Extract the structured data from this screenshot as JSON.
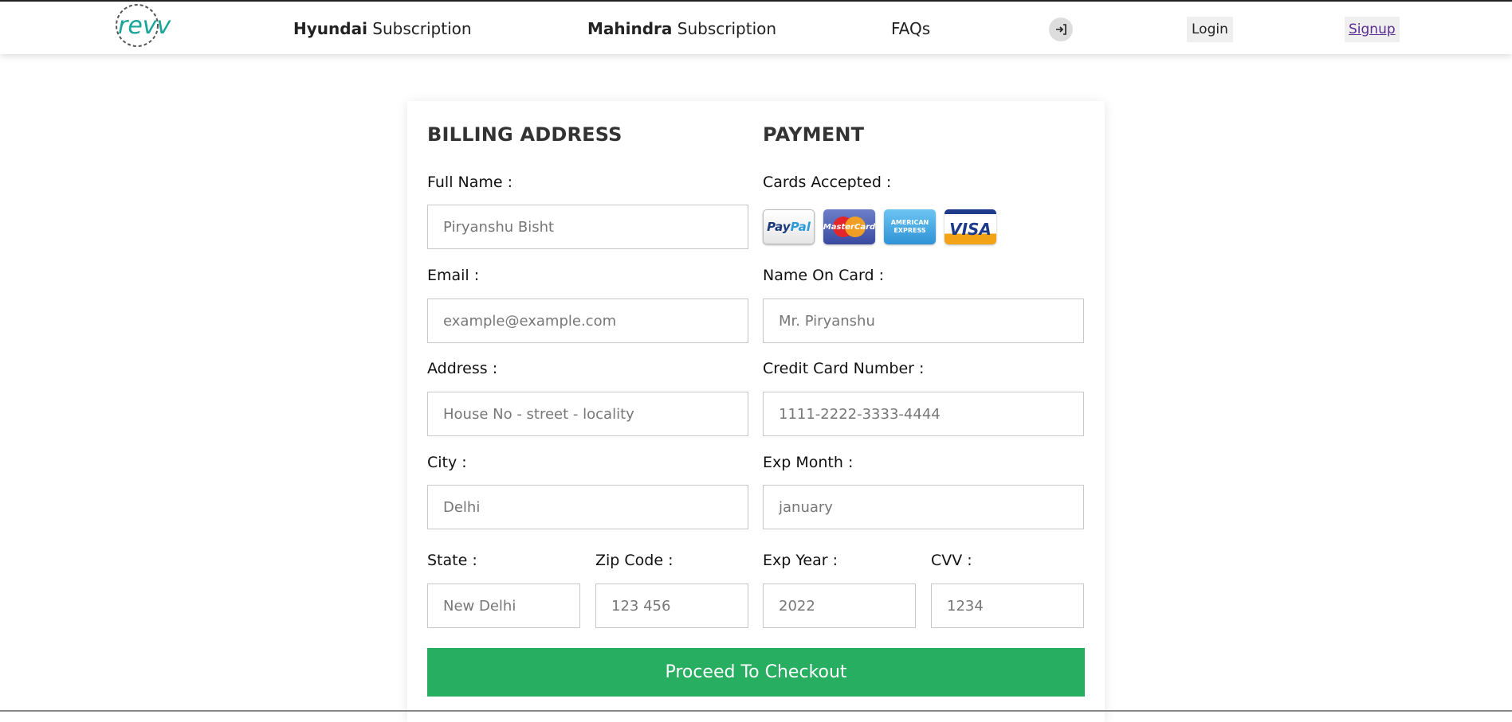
{
  "nav": {
    "logo_text": "revv",
    "links": [
      {
        "bold": "Hyundai",
        "rest": " Subscription"
      },
      {
        "bold": "Mahindra",
        "rest": " Subscription"
      },
      {
        "label": "FAQs"
      }
    ],
    "login_label": "Login",
    "signup_label": "Signup"
  },
  "billing": {
    "heading": "BILLING ADDRESS",
    "full_name": {
      "label": "Full Name :",
      "placeholder": "Piryanshu Bisht"
    },
    "email": {
      "label": "Email :",
      "placeholder": "example@example.com"
    },
    "address": {
      "label": "Address :",
      "placeholder": "House No - street - locality"
    },
    "city": {
      "label": "City :",
      "placeholder": "Delhi"
    },
    "state": {
      "label": "State :",
      "placeholder": "New Delhi"
    },
    "zip": {
      "label": "Zip Code :",
      "placeholder": "123 456"
    }
  },
  "payment": {
    "heading": "PAYMENT",
    "cards_label": "Cards Accepted :",
    "cards": [
      "PayPal",
      "MasterCard",
      "AMERICAN EXPRESS",
      "VISA"
    ],
    "name_on_card": {
      "label": "Name On Card :",
      "placeholder": "Mr. Piryanshu"
    },
    "card_number": {
      "label": "Credit Card Number :",
      "placeholder": "1111-2222-3333-4444"
    },
    "exp_month": {
      "label": "Exp Month :",
      "placeholder": "january"
    },
    "exp_year": {
      "label": "Exp Year :",
      "placeholder": "2022"
    },
    "cvv": {
      "label": "CVV :",
      "placeholder": "1234"
    }
  },
  "checkout_label": "Proceed To Checkout"
}
